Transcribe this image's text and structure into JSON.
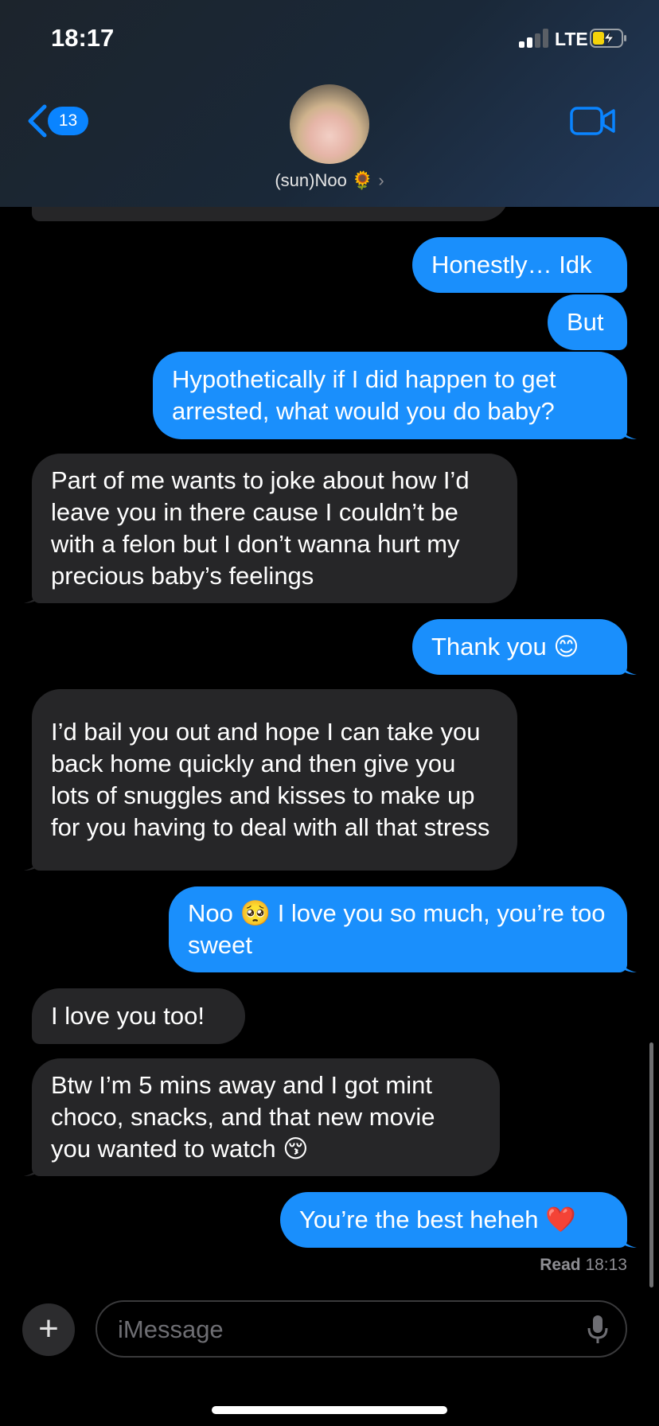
{
  "status_bar": {
    "time": "18:17",
    "network": "LTE"
  },
  "header": {
    "back_count": "13",
    "contact_name": "(sun)Noo 🌻",
    "chevron": "›"
  },
  "messages": [
    {
      "side": "in",
      "text": "",
      "partial": true
    },
    {
      "side": "out",
      "text": "Honestly… Idk"
    },
    {
      "side": "out",
      "text": "But"
    },
    {
      "side": "out",
      "text": "Hypothetically if I did happen to get arrested, what would you do baby?"
    },
    {
      "side": "in",
      "text": "Part of me wants to joke about how I’d leave you in there cause I couldn’t be with a felon but I don’t wanna hurt my precious baby’s feelings"
    },
    {
      "side": "out",
      "text": "Thank you 😊"
    },
    {
      "side": "in",
      "text": "I’d bail you out and hope I can take you back home quickly and then give you lots of snuggles and kisses to make up for you having to deal with all that stress"
    },
    {
      "side": "out",
      "text": "Noo 🥺 I love you so much, you’re too sweet"
    },
    {
      "side": "in",
      "text": "I love you too!"
    },
    {
      "side": "in",
      "text": "Btw I’m 5 mins away and I got mint choco, snacks, and that new movie you wanted to watch 😚"
    },
    {
      "side": "out",
      "text": "You’re the best heheh ❤️"
    }
  ],
  "read_receipt": {
    "label": "Read",
    "time": "18:13"
  },
  "composer": {
    "plus": "+",
    "placeholder": "iMessage"
  },
  "icons": [
    "back-chevron-icon",
    "video-camera-icon",
    "microphone-icon",
    "plus-icon",
    "battery-charging-icon",
    "signal-icon"
  ],
  "colors": {
    "accent": "#0a84ff",
    "outgoing_bubble": "#1a8ffc",
    "incoming_bubble": "#262628",
    "battery_charging": "#f4d30a"
  }
}
